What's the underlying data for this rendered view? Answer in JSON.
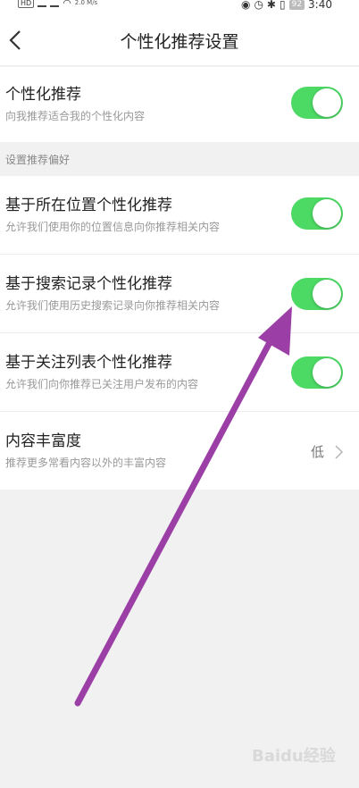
{
  "status_bar": {
    "hd_badge": "HD",
    "speed": "2.0 M/s",
    "battery": "92",
    "time": "3:40"
  },
  "header": {
    "title": "个性化推荐设置",
    "back_icon": "chevron-left-icon"
  },
  "main_setting": {
    "title": "个性化推荐",
    "subtitle": "向我推荐适合我的个性化内容",
    "enabled": true
  },
  "section_label": "设置推荐偏好",
  "preferences": [
    {
      "title": "基于所在位置个性化推荐",
      "subtitle": "允许我们使用你的位置信息向你推荐相关内容",
      "enabled": true
    },
    {
      "title": "基于搜索记录个性化推荐",
      "subtitle": "允许我们使用历史搜索记录向你推荐相关内容",
      "enabled": true
    },
    {
      "title": "基于关注列表个性化推荐",
      "subtitle": "允许我们向你推荐已关注用户发布的内容",
      "enabled": true
    }
  ],
  "richness": {
    "title": "内容丰富度",
    "subtitle": "推荐更多常看内容以外的丰富内容",
    "value": "低"
  },
  "colors": {
    "toggle_on": "#4cd964",
    "annotation_arrow": "#9b3fa6"
  },
  "watermark": "Baidu经验"
}
